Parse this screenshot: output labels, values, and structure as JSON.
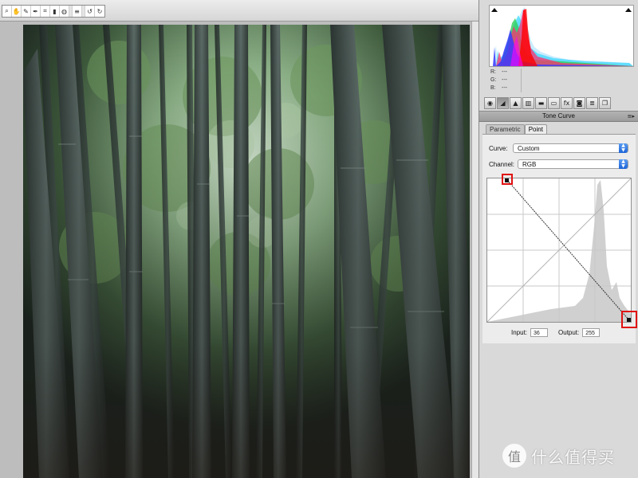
{
  "toolbar": {
    "tools": [
      {
        "name": "zoom-tool-icon",
        "glyph": "⌕"
      },
      {
        "name": "hand-tool-icon",
        "glyph": "✋"
      },
      {
        "name": "white-balance-tool-icon",
        "glyph": "✎"
      },
      {
        "name": "color-sampler-tool-icon",
        "glyph": "✒"
      },
      {
        "name": "crop-tool-icon",
        "glyph": "⌗"
      },
      {
        "name": "straighten-tool-icon",
        "glyph": "▮"
      },
      {
        "name": "spot-removal-tool-icon",
        "glyph": "◍"
      },
      {
        "name": "list-icon",
        "glyph": "≡"
      },
      {
        "name": "rotate-left-icon",
        "glyph": "↺"
      },
      {
        "name": "rotate-right-icon",
        "glyph": "↻"
      }
    ]
  },
  "readout": {
    "r_label": "R:",
    "r_value": "---",
    "g_label": "G:",
    "g_value": "---",
    "b_label": "B:",
    "b_value": "---"
  },
  "panel_icons": [
    {
      "name": "basic-panel-icon",
      "glyph": "◉"
    },
    {
      "name": "tone-curve-panel-icon",
      "glyph": "◢"
    },
    {
      "name": "detail-panel-icon",
      "glyph": "▲"
    },
    {
      "name": "hsl-panel-icon",
      "glyph": "▥"
    },
    {
      "name": "split-toning-panel-icon",
      "glyph": "▬"
    },
    {
      "name": "lens-corrections-panel-icon",
      "glyph": "▭"
    },
    {
      "name": "effects-panel-icon",
      "glyph": "fx"
    },
    {
      "name": "camera-calibration-panel-icon",
      "glyph": "◙"
    },
    {
      "name": "presets-panel-icon",
      "glyph": "≣"
    },
    {
      "name": "snapshots-panel-icon",
      "glyph": "❐"
    }
  ],
  "panel": {
    "title": "Tone Curve",
    "menu_glyph": "≡▸",
    "tabs": [
      {
        "label": "Parametric",
        "active": false
      },
      {
        "label": "Point",
        "active": true
      }
    ]
  },
  "curve_controls": {
    "curve_label": "Curve:",
    "curve_value": "Custom",
    "channel_label": "Channel:",
    "channel_value": "RGB"
  },
  "io": {
    "input_label": "Input:",
    "input_value": "36",
    "output_label": "Output:",
    "output_value": "255"
  },
  "watermark": {
    "badge": "值",
    "text": "什么值得买"
  },
  "colors": {
    "marker": "#e01010",
    "select_accent": "#1c64d8",
    "histogram_gray": "#d0d0d0"
  }
}
